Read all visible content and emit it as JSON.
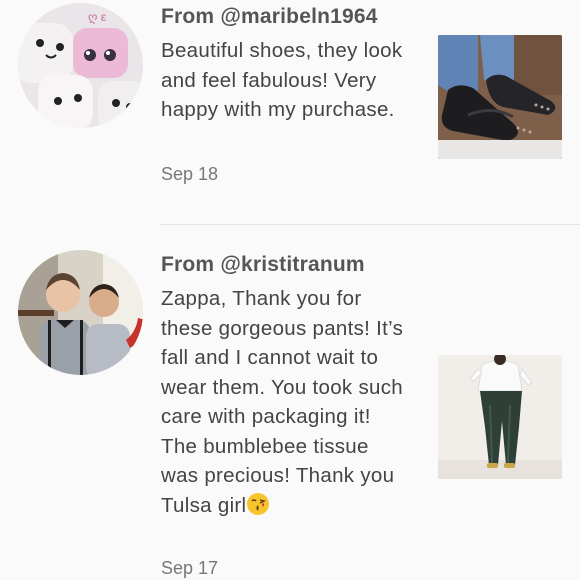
{
  "reviews": [
    {
      "author": "From @maribeln1964",
      "text": "Beautiful shoes, they look and feel fabulous! Very happy with my purchase.",
      "date": "Sep 18"
    },
    {
      "author": "From @kristitranum",
      "text": "Zappa, Thank you for these gorgeous pants! It’s fall and I cannot wait to wear them. You took such care with packaging it! The bumblebee tissue was precious! Thank you Tulsa girl",
      "emoji": "kissing-face-emoji",
      "date": "Sep 17"
    }
  ],
  "colors": {
    "background": "#fbfafa",
    "author_text": "#555555",
    "body_text": "#444444",
    "date_text": "#777777",
    "divider": "#e6e3e3"
  }
}
